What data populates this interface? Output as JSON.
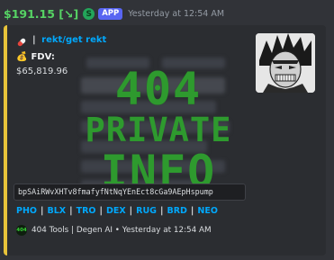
{
  "header": {
    "username": "$191.15 [↘]",
    "bot_icon": "S",
    "app_tag": "APP",
    "timestamp": "Yesterday at 12:54 AM"
  },
  "embed": {
    "accent_color": "#e8c33a",
    "title_link": "rekt/get rekt",
    "title_separator": "|",
    "fdv_label": "FDV:",
    "fdv_value": "$65,819.96",
    "overlay_line1": "404",
    "overlay_line2": "PRIVATE",
    "overlay_line3": "INFO",
    "contract_address": "bpSAiRWvXHTv8fmafyfNtNqYEnEct8cGa9AEpHspump",
    "links": [
      "PHO",
      "BLX",
      "TRO",
      "DEX",
      "RUG",
      "BRD",
      "NEO"
    ],
    "link_separator": "|",
    "footer_icon_text": "404",
    "footer_text": "404 Tools | Degen AI • Yesterday at 12:54 AM"
  },
  "icons": {
    "title_icon": "pill-icon",
    "fdv_icon": "money-bag-icon",
    "thumbnail": "anime-avatar-thumbnail"
  }
}
